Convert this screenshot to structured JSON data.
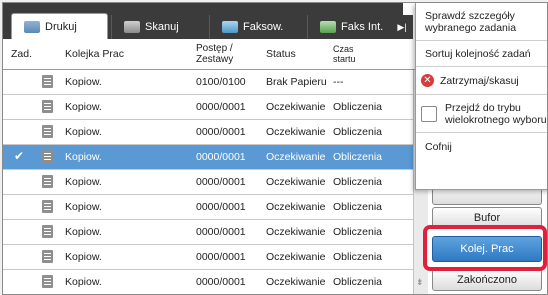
{
  "tabs": [
    {
      "label": "Drukuj",
      "icon": "print-icon"
    },
    {
      "label": "Skanuj",
      "icon": "scan-icon"
    },
    {
      "label": "Faksow.",
      "icon": "fax-icon"
    },
    {
      "label": "Faks Int.",
      "icon": "internet-fax-icon"
    }
  ],
  "table": {
    "headers": {
      "zad": "Zad.",
      "queue": "Kolejka Prac",
      "progress_line1": "Postęp /",
      "progress_line2": "Zestawy",
      "status": "Status",
      "time_line1": "Czas",
      "time_line2": "startu"
    },
    "rows": [
      {
        "name": "Kopiow.",
        "progress": "0100/0100",
        "status": "Brak Papieru",
        "time": "---",
        "selected": false
      },
      {
        "name": "Kopiow.",
        "progress": "0000/0001",
        "status": "Oczekiwanie",
        "time": "Obliczenia",
        "selected": false
      },
      {
        "name": "Kopiow.",
        "progress": "0000/0001",
        "status": "Oczekiwanie",
        "time": "Obliczenia",
        "selected": false
      },
      {
        "name": "Kopiow.",
        "progress": "0000/0001",
        "status": "Oczekiwanie",
        "time": "Obliczenia",
        "selected": true
      },
      {
        "name": "Kopiow.",
        "progress": "0000/0001",
        "status": "Oczekiwanie",
        "time": "Obliczenia",
        "selected": false
      },
      {
        "name": "Kopiow.",
        "progress": "0000/0001",
        "status": "Oczekiwanie",
        "time": "Obliczenia",
        "selected": false
      },
      {
        "name": "Kopiow.",
        "progress": "0000/0001",
        "status": "Oczekiwanie",
        "time": "Obliczenia",
        "selected": false
      },
      {
        "name": "Kopiow.",
        "progress": "0000/0001",
        "status": "Oczekiwanie",
        "time": "Obliczenia",
        "selected": false
      },
      {
        "name": "Kopiow.",
        "progress": "0000/0001",
        "status": "Oczekiwanie",
        "time": "Obliczenia",
        "selected": false
      }
    ]
  },
  "menu": {
    "check_details_line1": "Sprawdź szczegóły",
    "check_details_line2": "wybranego zadania",
    "sort_order": "Sortuj kolejność zadań",
    "pause_cancel": "Zatrzymaj/skasuj",
    "multi_select_line1": "Przejdź do trybu",
    "multi_select_line2": "wielokrotnego wyboru",
    "back": "Cofnij"
  },
  "side_buttons": {
    "spool": "Bufor",
    "job_queue": "Kolej. Prac",
    "complete": "Zakończono"
  },
  "colors": {
    "accent": "#2f79c2",
    "highlight": "#e0203c",
    "selected_row": "#5a99d4"
  }
}
